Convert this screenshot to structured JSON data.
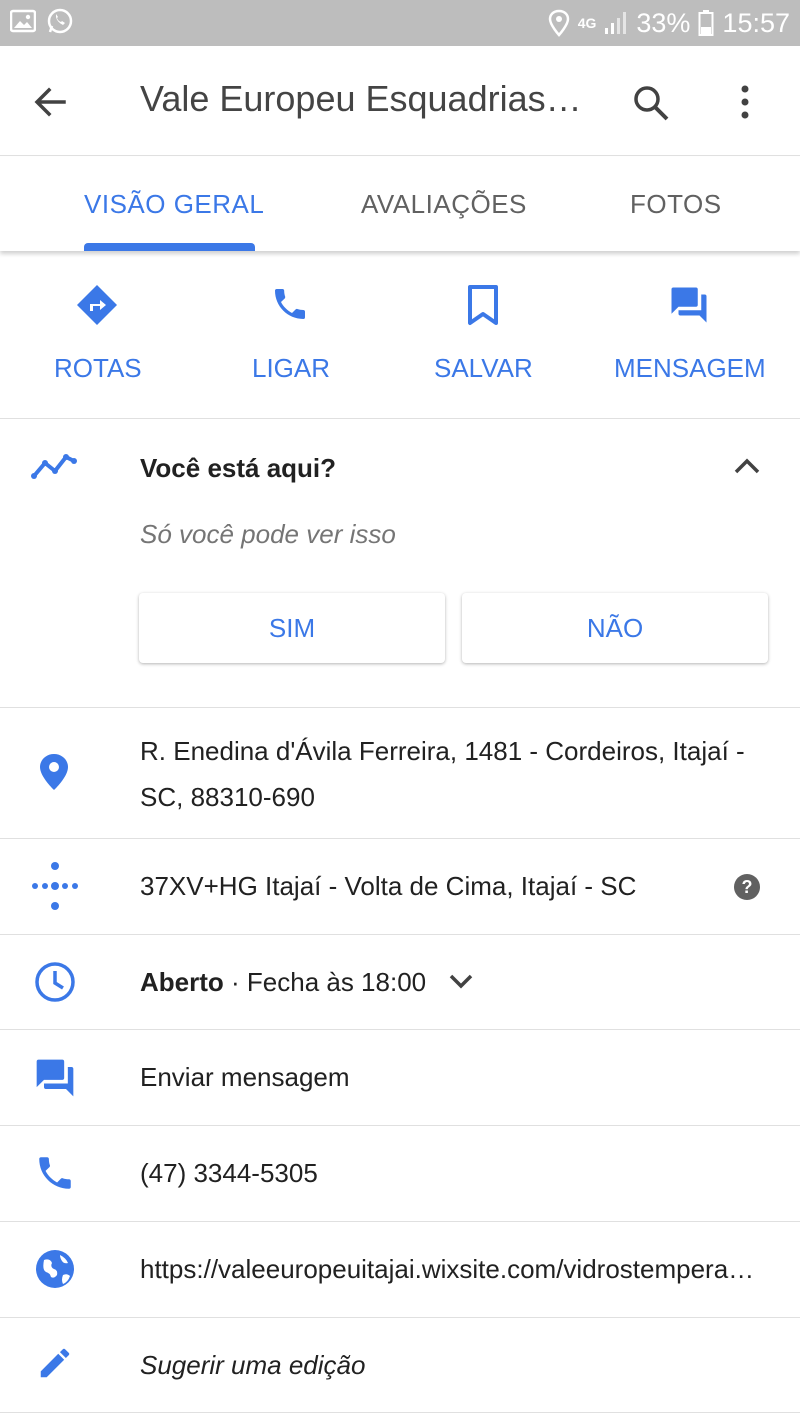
{
  "status_bar": {
    "battery": "33%",
    "time": "15:57",
    "network": "4G"
  },
  "app_bar": {
    "title": "Vale Europeu Esquadrias…"
  },
  "tabs": [
    {
      "label": "VISÃO GERAL",
      "active": true
    },
    {
      "label": "AVALIAÇÕES",
      "active": false
    },
    {
      "label": "FOTOS",
      "active": false
    }
  ],
  "actions": [
    {
      "label": "ROTAS",
      "icon": "directions-icon"
    },
    {
      "label": "LIGAR",
      "icon": "phone-icon"
    },
    {
      "label": "SALVAR",
      "icon": "bookmark-icon"
    },
    {
      "label": "MENSAGEM",
      "icon": "message-icon"
    }
  ],
  "here_card": {
    "question": "Você está aqui?",
    "subtitle": "Só você pode ver isso",
    "yes": "SIM",
    "no": "NÃO"
  },
  "info": {
    "address": "R. Enedina d'Ávila Ferreira, 1481 - Cordeiros, Itajaí - SC, 88310-690",
    "plus_code": "37XV+HG Itajaí - Volta de Cima, Itajaí - SC",
    "hours_status": "Aberto",
    "hours_detail": " · Fecha às 18:00",
    "message": "Enviar mensagem",
    "phone": "(47) 3344-5305",
    "website": "https://valeeuropeuitajai.wixsite.com/vidrostemperados",
    "suggest_edit": "Sugerir uma edição"
  },
  "colors": {
    "accent": "#3b78e7",
    "status_bar": "#bdbdbd"
  }
}
